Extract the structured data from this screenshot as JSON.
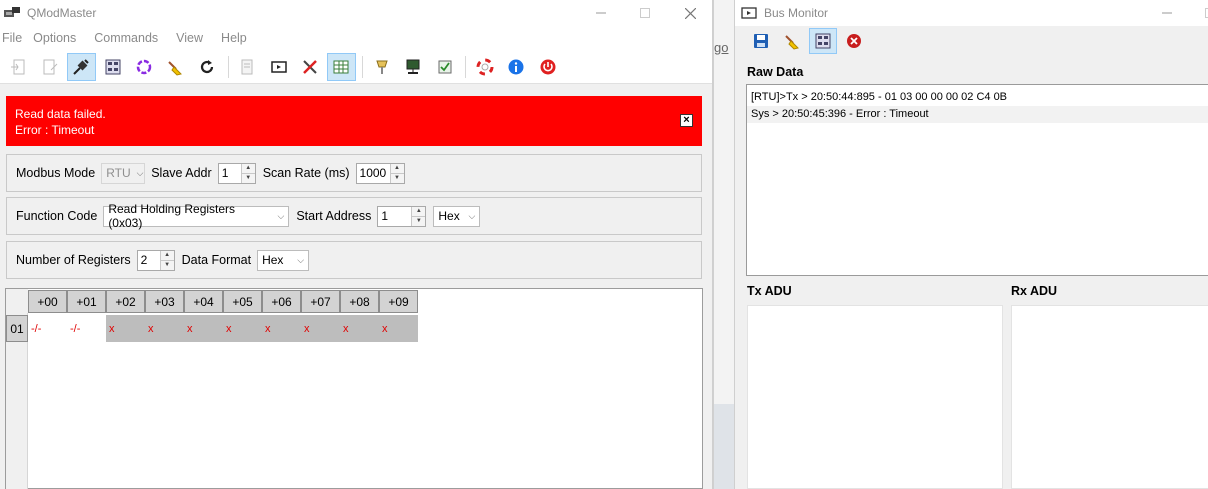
{
  "qmodmaster": {
    "title": "QModMaster",
    "menu": [
      "File",
      "Options",
      "Commands",
      "View",
      "Help"
    ],
    "toolbar_icons": [
      "connect-icon",
      "disconnect-icon",
      "connect-toggle-icon",
      "bus-monitor-icon",
      "scan-icon",
      "clear-icon",
      "read-write-icon",
      "log-icon",
      "monitor-icon",
      "tools-icon",
      "table-icon",
      "modbus-rtu-icon",
      "modbus-tcp-icon",
      "settings-icon",
      "help-icon",
      "info-icon",
      "exit-icon"
    ],
    "error": {
      "line1": "Read data failed.",
      "line2": "Error : Timeout",
      "color": "#ff0000"
    },
    "mode_row": {
      "mode_label": "Modbus Mode",
      "mode_value": "RTU",
      "slave_label": "Slave Addr",
      "slave_value": "1",
      "scan_label": "Scan Rate (ms)",
      "scan_value": "1000"
    },
    "function_row": {
      "function_label": "Function Code",
      "function_value": "Read Holding Registers (0x03)",
      "start_label": "Start Address",
      "start_value": "1",
      "base_value": "Hex"
    },
    "registers_row": {
      "count_label": "Number of Registers",
      "count_value": "2",
      "format_label": "Data Format",
      "format_value": "Hex"
    },
    "grid": {
      "columns": [
        "+00",
        "+01",
        "+02",
        "+03",
        "+04",
        "+05",
        "+06",
        "+07",
        "+08",
        "+09"
      ],
      "row_label": "01",
      "cells": [
        "-/-",
        "-/-",
        "x",
        "x",
        "x",
        "x",
        "x",
        "x",
        "x",
        "x"
      ]
    }
  },
  "desktop": {
    "partial_text": "go"
  },
  "bus_monitor": {
    "title": "Bus Monitor",
    "raw_label": "Raw Data",
    "raw_lines": [
      "[RTU]>Tx > 20:50:44:895 - 01  03  00  00  00  02  C4  0B",
      "Sys > 20:50:45:396 - Error : Timeout"
    ],
    "tx_label": "Tx ADU",
    "rx_label": "Rx ADU"
  }
}
